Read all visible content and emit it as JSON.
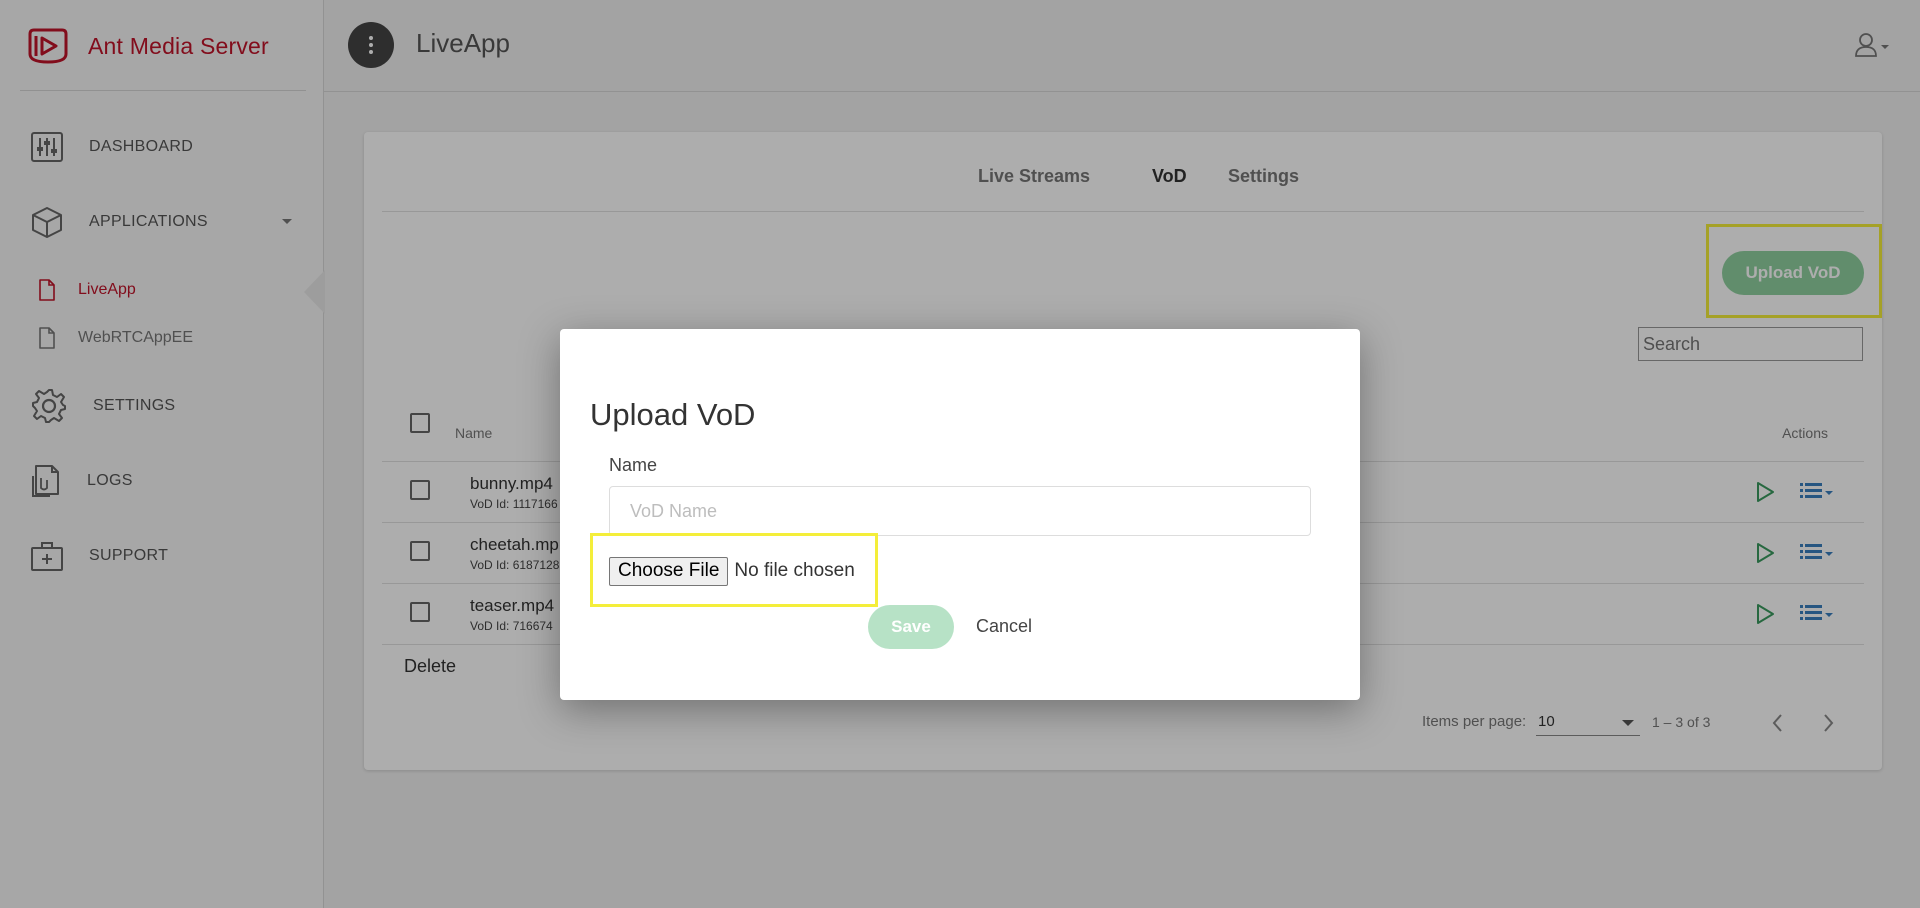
{
  "brand": {
    "name": "Ant Media Server",
    "color": "#c0142a"
  },
  "sidebar": {
    "items": [
      {
        "label": "DASHBOARD",
        "icon": "sliders-icon"
      },
      {
        "label": "APPLICATIONS",
        "icon": "box-icon"
      },
      {
        "label": "SETTINGS",
        "icon": "gear-icon"
      },
      {
        "label": "LOGS",
        "icon": "document-icon"
      },
      {
        "label": "SUPPORT",
        "icon": "medical-kit-icon"
      }
    ],
    "apps": [
      {
        "label": "LiveApp",
        "active": true
      },
      {
        "label": "WebRTCAppEE",
        "active": false
      }
    ]
  },
  "header": {
    "title": "LiveApp"
  },
  "tabs": [
    {
      "label": "Live Streams"
    },
    {
      "label": "VoD",
      "active": true
    },
    {
      "label": "Settings"
    }
  ],
  "toolbar": {
    "upload_label": "Upload VoD",
    "search_placeholder": "Search"
  },
  "table": {
    "headers": {
      "name": "Name",
      "actions": "Actions"
    },
    "rows": [
      {
        "name": "bunny.mp4",
        "id": "VoD Id: 1117166"
      },
      {
        "name": "cheetah.mp",
        "id": "VoD Id: 6187128"
      },
      {
        "name": "teaser.mp4",
        "id": "VoD Id: 716674"
      }
    ],
    "delete_label": "Delete"
  },
  "pagination": {
    "items_label": "Items per page:",
    "per_page": "10",
    "range": "1 – 3 of 3"
  },
  "modal": {
    "title": "Upload VoD",
    "name_label": "Name",
    "name_placeholder": "VoD Name",
    "choose_file_label": "Choose File",
    "no_file_label": "No file chosen",
    "save_label": "Save",
    "cancel_label": "Cancel"
  },
  "colors": {
    "accent_green": "#8fd0a0",
    "highlight": "#f4ee3a"
  }
}
